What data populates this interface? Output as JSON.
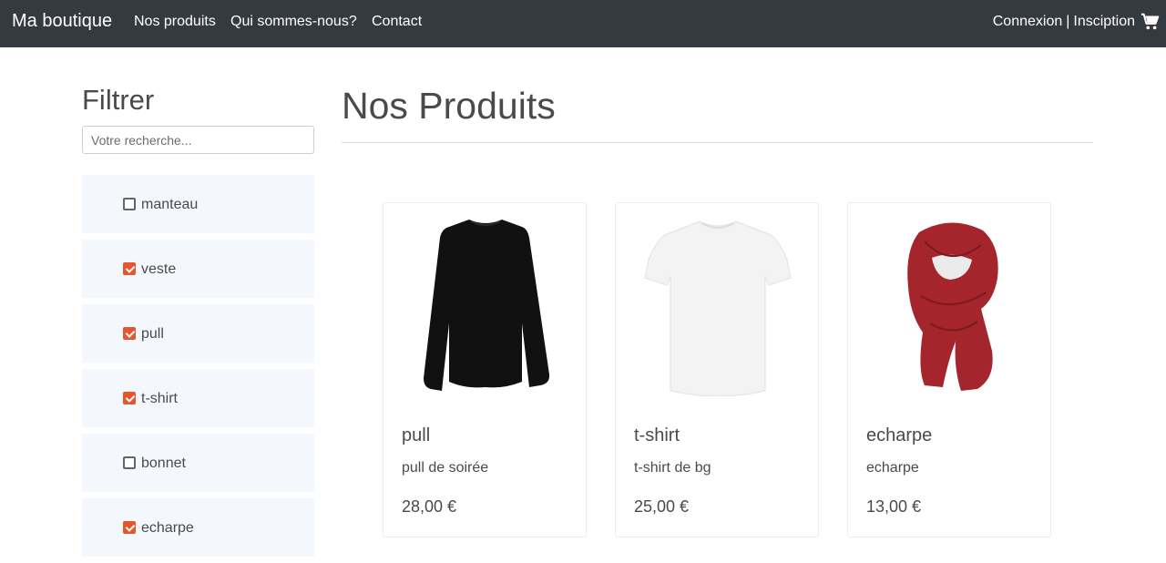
{
  "navbar": {
    "brand": "Ma boutique",
    "links": [
      "Nos produits",
      "Qui sommes-nous?",
      "Contact"
    ],
    "login": "Connexion",
    "separator": "|",
    "register": "Insciption",
    "cart_icon": "cart-icon"
  },
  "sidebar": {
    "title": "Filtrer",
    "search_placeholder": "Votre recherche...",
    "search_value": "",
    "categories": [
      {
        "label": "manteau",
        "checked": false
      },
      {
        "label": "veste",
        "checked": true
      },
      {
        "label": "pull",
        "checked": true
      },
      {
        "label": "t-shirt",
        "checked": true
      },
      {
        "label": "bonnet",
        "checked": false
      },
      {
        "label": "echarpe",
        "checked": true
      }
    ]
  },
  "main": {
    "title": "Nos Produits",
    "products": [
      {
        "name": "pull",
        "description": "pull de soirée",
        "price": "28,00 €",
        "image": "black-long-sleeve-shirt"
      },
      {
        "name": "t-shirt",
        "description": "t-shirt de bg",
        "price": "25,00 €",
        "image": "white-t-shirt"
      },
      {
        "name": "echarpe",
        "description": "echarpe",
        "price": "13,00 €",
        "image": "red-scarf"
      }
    ]
  },
  "colors": {
    "navbar_bg": "#343a40",
    "accent_checkbox": "#e4572e",
    "category_bg": "#f4f8fd"
  }
}
